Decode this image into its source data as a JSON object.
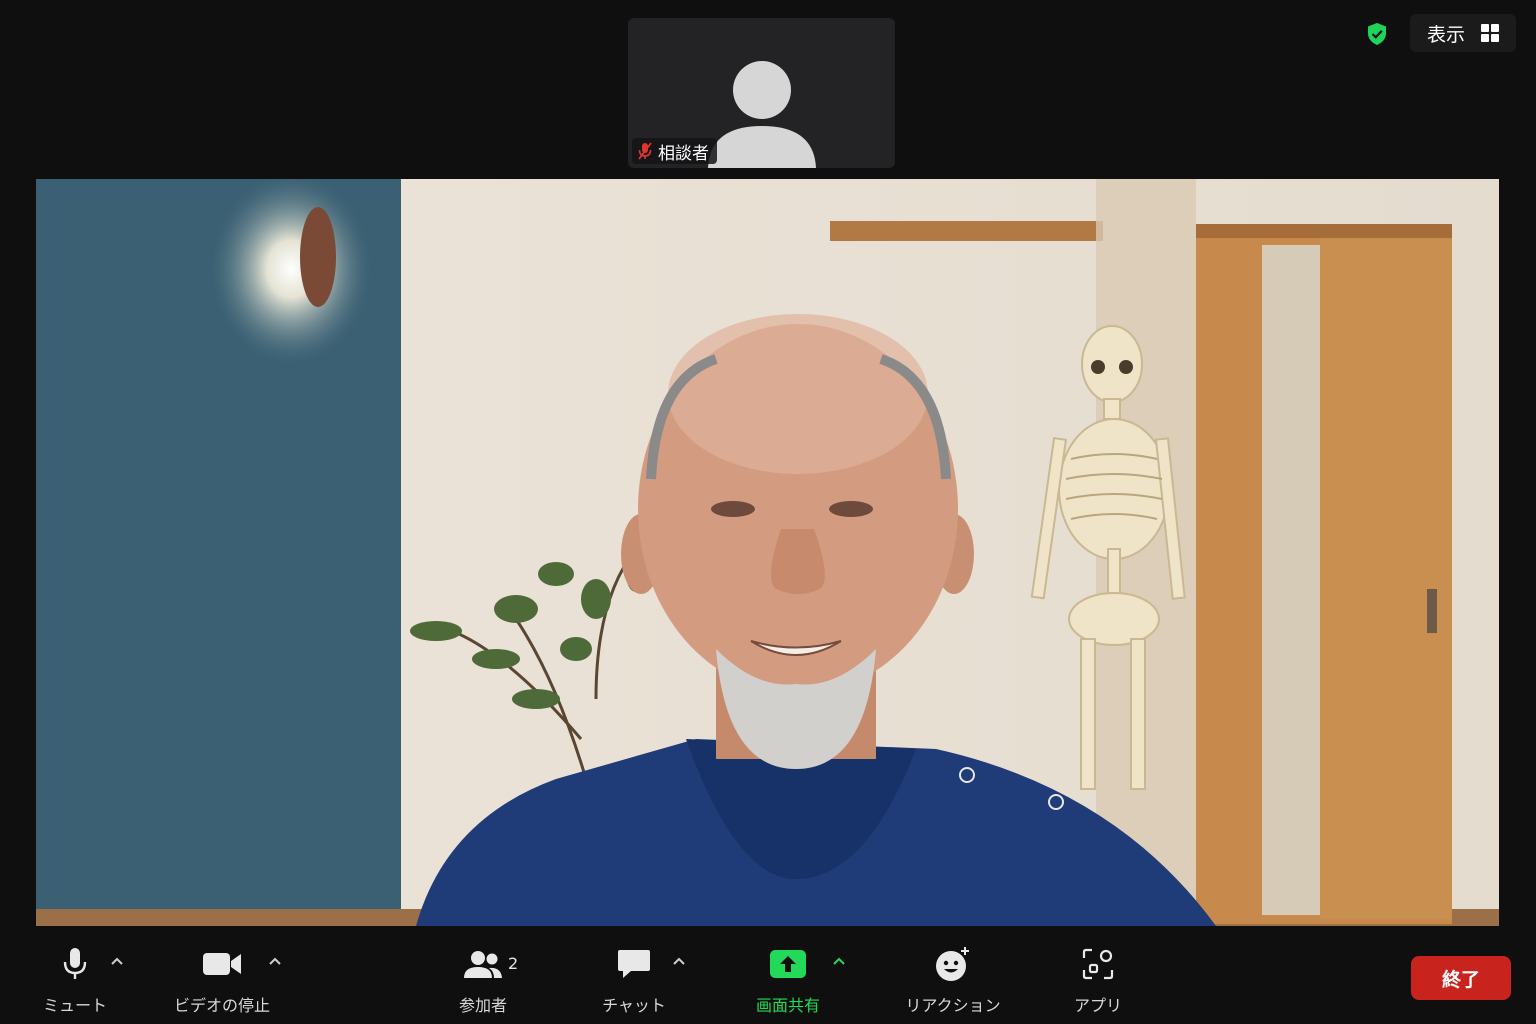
{
  "participant": {
    "name": "相談者",
    "muted": true
  },
  "view_button": {
    "label": "表示"
  },
  "toolbar": {
    "mute": "ミュート",
    "video": "ビデオの停止",
    "participants": "参加者",
    "participant_count": "2",
    "chat": "チャット",
    "share": "画面共有",
    "reactions": "リアクション",
    "apps": "アプリ",
    "end": "終了"
  },
  "colors": {
    "share_green": "#23d959",
    "end_red": "#c9231e",
    "shield_green": "#1fd35a",
    "mute_red": "#e0342d"
  },
  "icons": [
    "shield-icon",
    "grid-view-icon",
    "muted-mic-icon",
    "mic-icon",
    "video-camera-icon",
    "participants-icon",
    "chat-icon",
    "share-screen-icon",
    "reaction-icon",
    "apps-icon",
    "chevron-up-icon"
  ]
}
